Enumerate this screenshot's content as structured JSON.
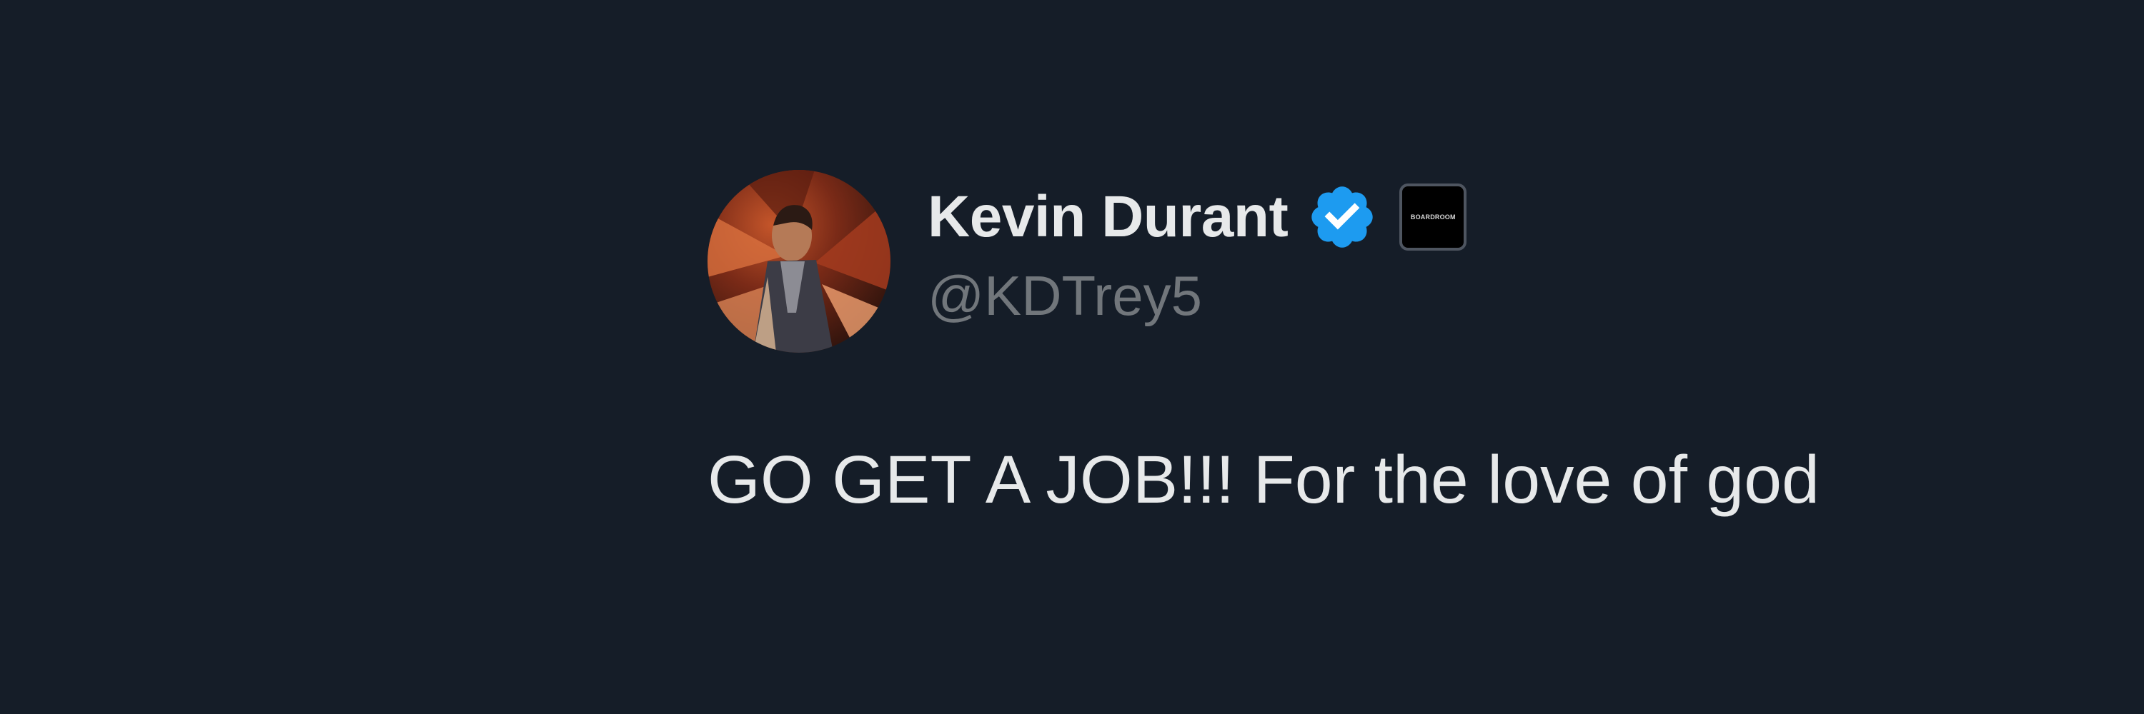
{
  "tweet": {
    "author": {
      "display_name": "Kevin Durant",
      "handle": "@KDTrey5",
      "verified_icon": "verified-badge-icon",
      "affiliate_badge_text": "BOARDROOM",
      "avatar_icon": "profile-avatar"
    },
    "text": "GO GET A JOB!!! For the love of god"
  },
  "colors": {
    "background": "#151d28",
    "primary_text": "#e7e9ea",
    "secondary_text": "#71767b",
    "verified_blue": "#1d9bf0"
  }
}
